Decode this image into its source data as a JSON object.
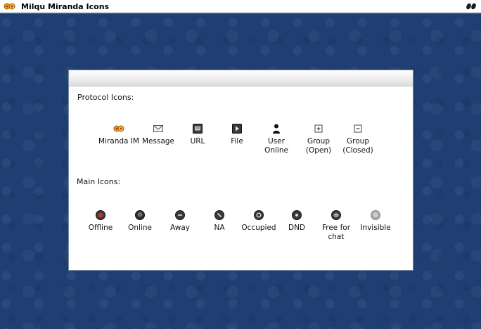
{
  "window": {
    "title": "Milqu Miranda Icons"
  },
  "panel": {
    "protocol_section_title": "Protocol Icons:",
    "main_section_title": "Main Icons:",
    "protocol_icons": [
      {
        "label": "Miranda IM",
        "icon": "miranda-logo-icon"
      },
      {
        "label": "Message",
        "icon": "envelope-icon"
      },
      {
        "label": "URL",
        "icon": "url-icon"
      },
      {
        "label": "File",
        "icon": "file-icon"
      },
      {
        "label": "User Online",
        "icon": "user-icon"
      },
      {
        "label": "Group (Open)",
        "icon": "group-open-icon"
      },
      {
        "label": "Group (Closed)",
        "icon": "group-closed-icon"
      }
    ],
    "main_icons": [
      {
        "label": "Offline",
        "icon": "offline-status-icon"
      },
      {
        "label": "Online",
        "icon": "online-status-icon"
      },
      {
        "label": "Away",
        "icon": "away-status-icon"
      },
      {
        "label": "NA",
        "icon": "na-status-icon"
      },
      {
        "label": "Occupied",
        "icon": "occupied-status-icon"
      },
      {
        "label": "DND",
        "icon": "dnd-status-icon"
      },
      {
        "label": "Free for chat",
        "icon": "free-for-chat-status-icon"
      },
      {
        "label": "Invisible",
        "icon": "invisible-status-icon"
      }
    ]
  },
  "colors": {
    "background": "#1f3f73",
    "titlebar_border": "#40618f",
    "panel_border": "#7d8fa8"
  }
}
